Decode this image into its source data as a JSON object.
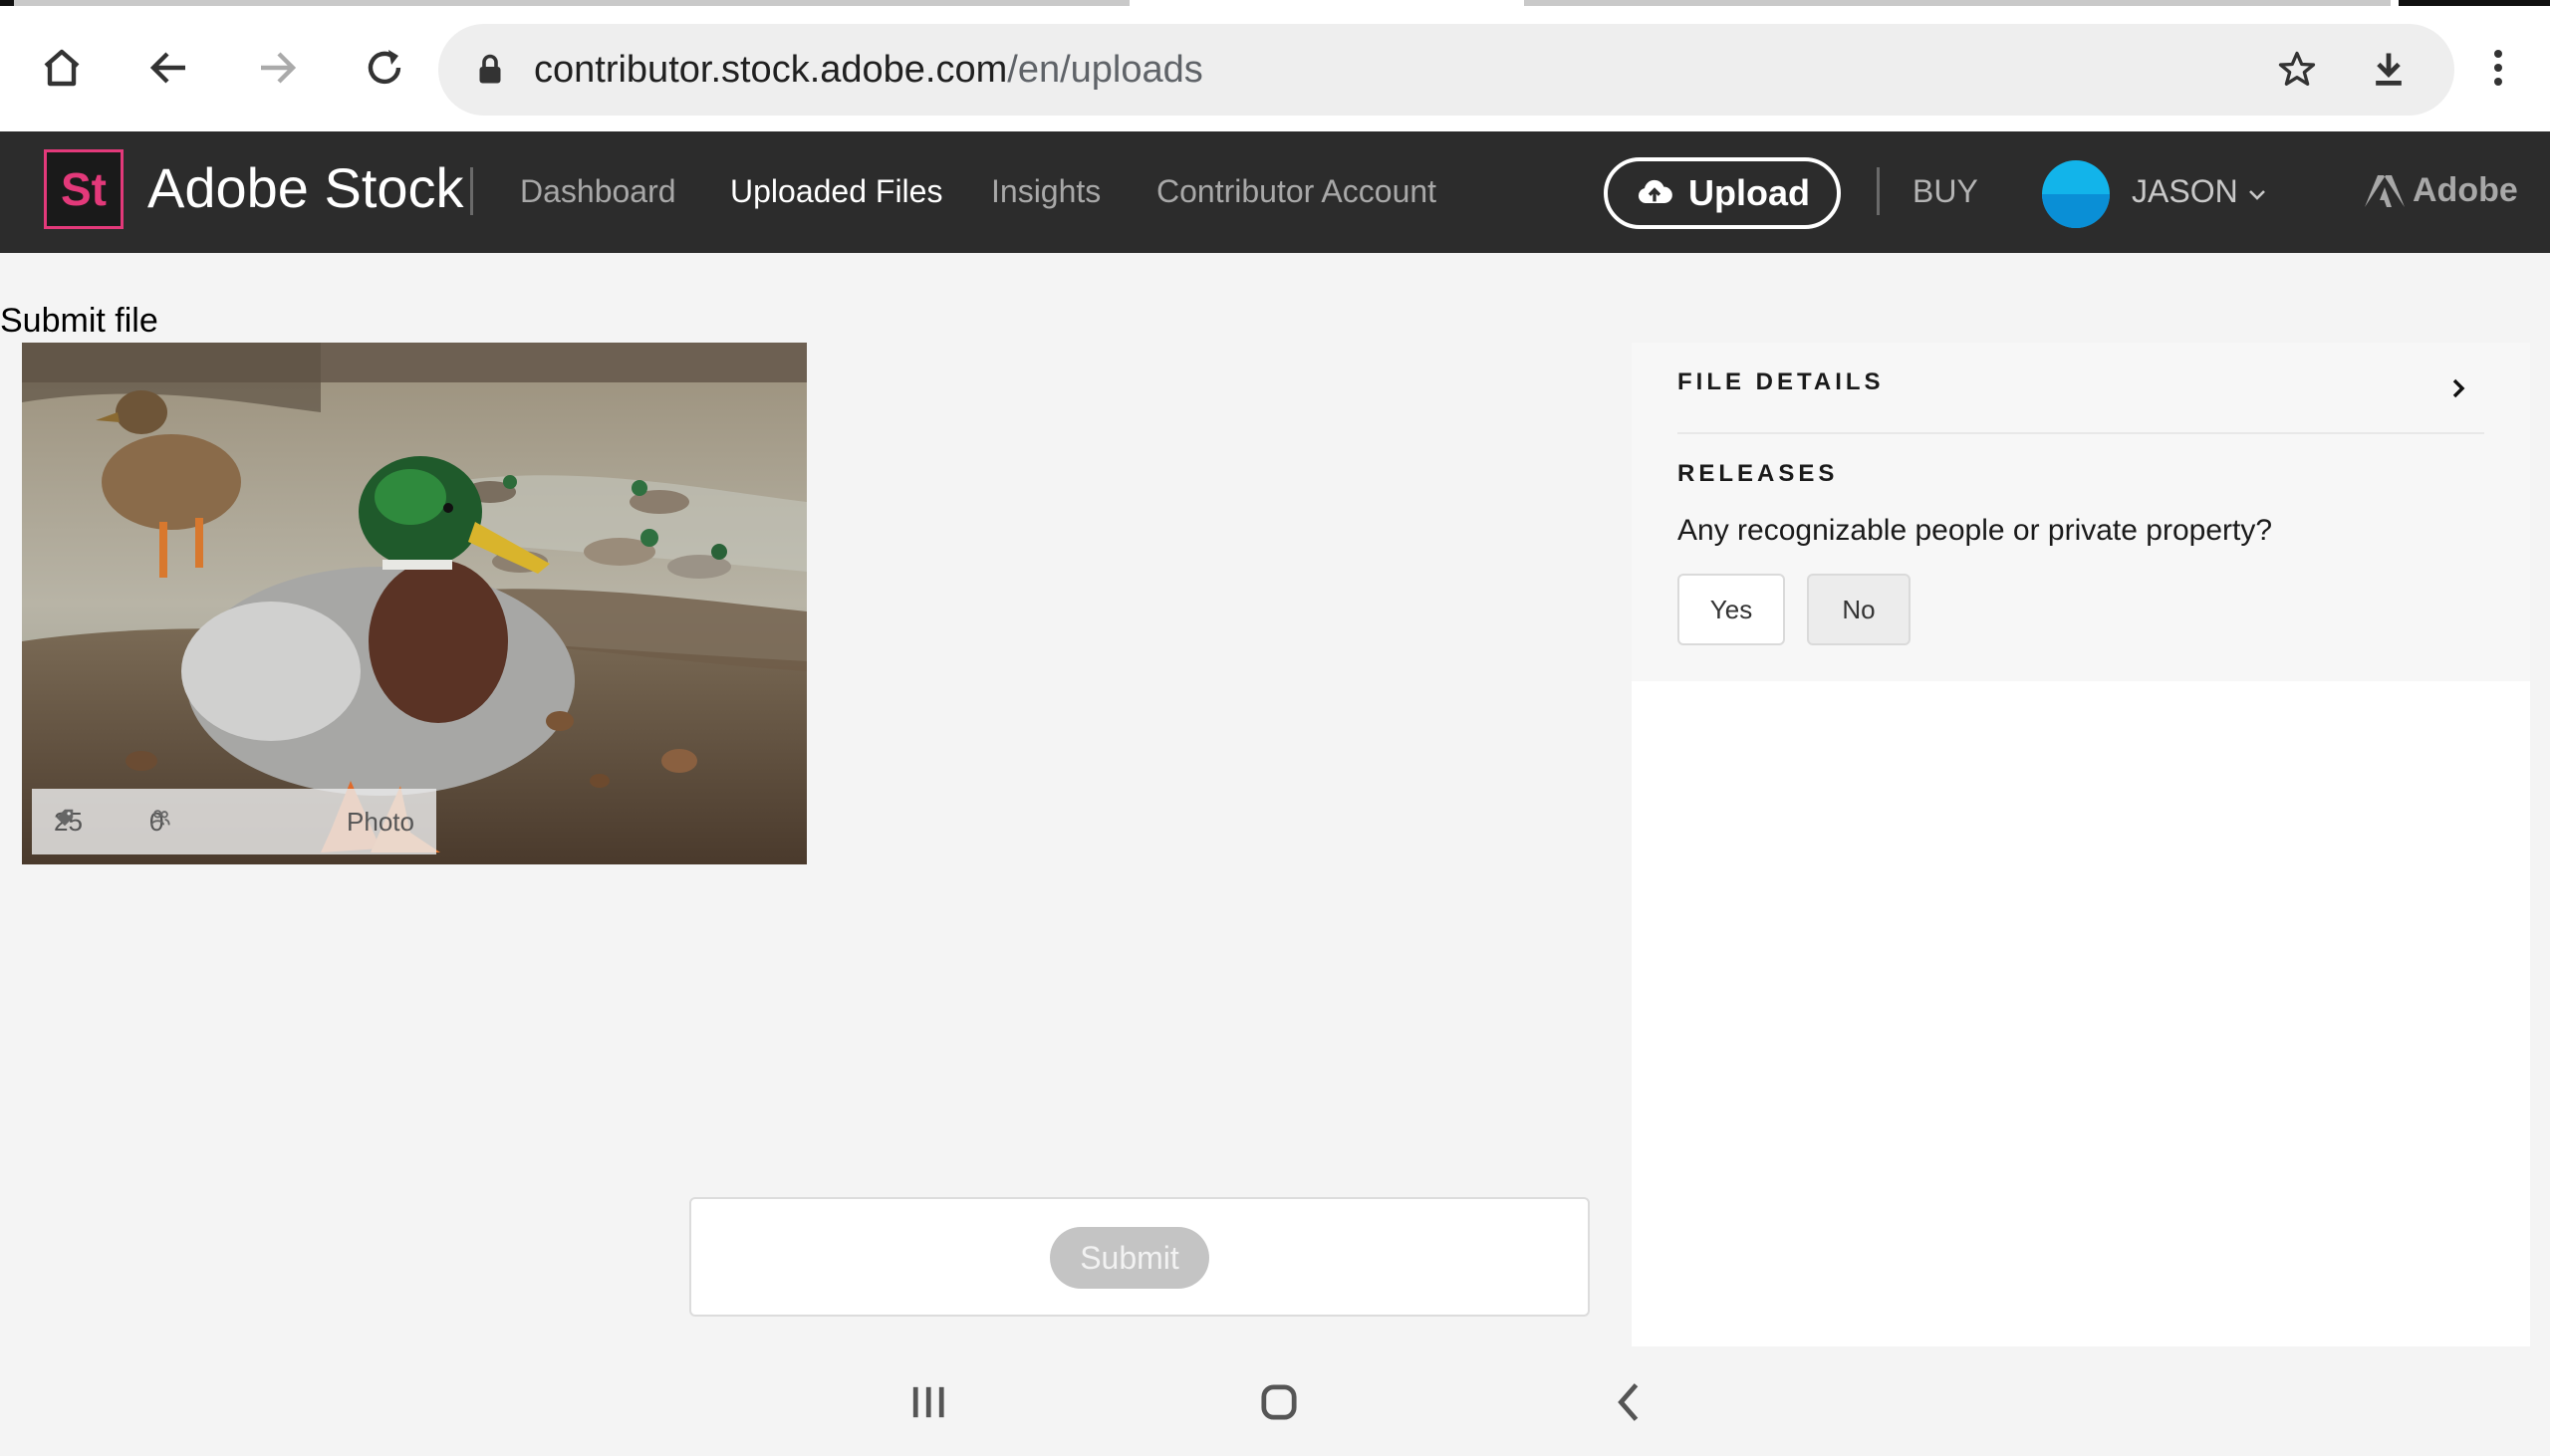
{
  "browser": {
    "url_host": "contributor.stock.adobe.com",
    "url_path": "/en/uploads"
  },
  "header": {
    "logo_text": "St",
    "brand": "Adobe Stock",
    "nav": [
      {
        "label": "Dashboard",
        "active": false
      },
      {
        "label": "Uploaded Files",
        "active": true
      },
      {
        "label": "Insights",
        "active": false
      },
      {
        "label": "Contributor Account",
        "active": false
      }
    ],
    "upload_label": "Upload",
    "buy_label": "BUY",
    "user_name": "JASON",
    "adobe_label": "Adobe"
  },
  "main": {
    "title": "Submit file",
    "file": {
      "keywords_count": "25",
      "releases_count": "0",
      "type": "Photo"
    },
    "submit_label": "Submit"
  },
  "panel": {
    "file_details_title": "FILE DETAILS",
    "releases_title": "RELEASES",
    "question": "Any recognizable people or private property?",
    "yes_label": "Yes",
    "no_label": "No"
  },
  "colors": {
    "header_bg": "#2c2c2c",
    "stock_pink": "#e3397a",
    "avatar_blue": "#12b4ea"
  }
}
